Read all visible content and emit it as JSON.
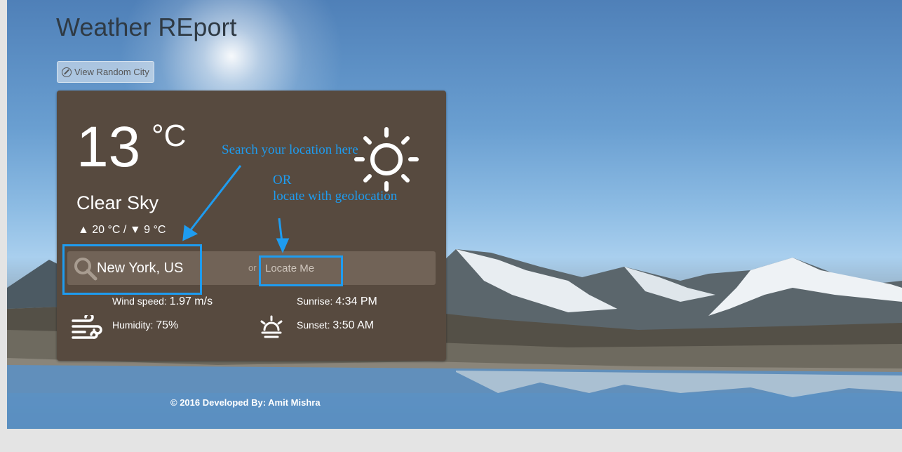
{
  "header": {
    "title": "Weather REport"
  },
  "toolbar": {
    "random_city_label": "View Random City",
    "random_city_icon": "compass-icon"
  },
  "weather": {
    "temperature": "13",
    "unit": "°C",
    "condition": "Clear Sky",
    "minmax": "▲ 20 °C / ▼ 9 °C",
    "icon": "sun-icon"
  },
  "search": {
    "value": "New York, US",
    "or_label": "or",
    "locate_label": "Locate Me"
  },
  "stats": {
    "wind_label": "Wind speed:",
    "wind_value": "1.97 m/s",
    "humidity_label": "Humidity:",
    "humidity_value": "75%",
    "sunrise_label": "Sunrise:",
    "sunrise_value": "4:34 PM",
    "sunset_label": "Sunset:",
    "sunset_value": "3:50 AM"
  },
  "annotations": {
    "search_hint": "Search your location here",
    "or": "OR",
    "geo_hint": "locate with geolocation"
  },
  "footer": {
    "text": "© 2016 Developed By: Amit Mishra"
  },
  "colors": {
    "card_bg": "#574a3f",
    "annotation": "#1e9cf0",
    "search_bar": "#716357"
  }
}
